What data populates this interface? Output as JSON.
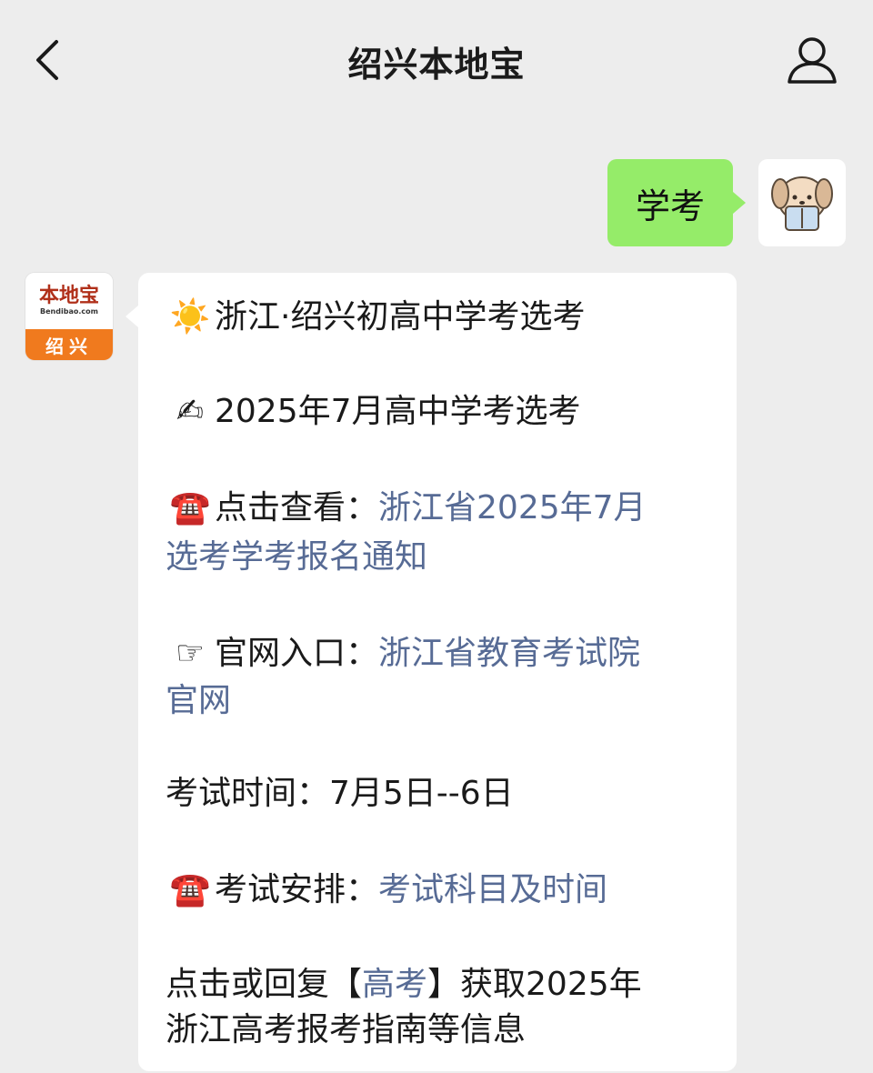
{
  "header": {
    "title": "绍兴本地宝"
  },
  "outgoing": {
    "text": "学考"
  },
  "bot_avatar": {
    "logo_main": "本地宝",
    "logo_sub": "Bendibao.com",
    "city": "绍兴"
  },
  "message": {
    "line1": {
      "icon": "☀️",
      "text": "浙江·绍兴初高中学考选考"
    },
    "line2": {
      "icon": "✍",
      "text": "2025年7月高中学考选考"
    },
    "line3": {
      "icon": "☎️",
      "label": "点击查看：",
      "link_a": "浙江省2025年7月",
      "link_b": "选考学考报名通知"
    },
    "line4": {
      "icon": "☞",
      "label": "官网入口：",
      "link_a": "浙江省教育考试院",
      "link_b": "官网"
    },
    "line5": {
      "text": "考试时间：7月5日--6日"
    },
    "line6": {
      "icon": "☎️",
      "label": "考试安排：",
      "link": "考试科目及时间"
    },
    "line7": {
      "pre": "点击或回复【",
      "link": "高考",
      "post": "】获取2025年",
      "next": "浙江高考报考指南等信息"
    }
  },
  "colors": {
    "background": "#ededed",
    "outgoing_bubble": "#95ec69",
    "incoming_bubble": "#ffffff",
    "link": "#576b95",
    "logo_orange": "#f07a1e"
  }
}
